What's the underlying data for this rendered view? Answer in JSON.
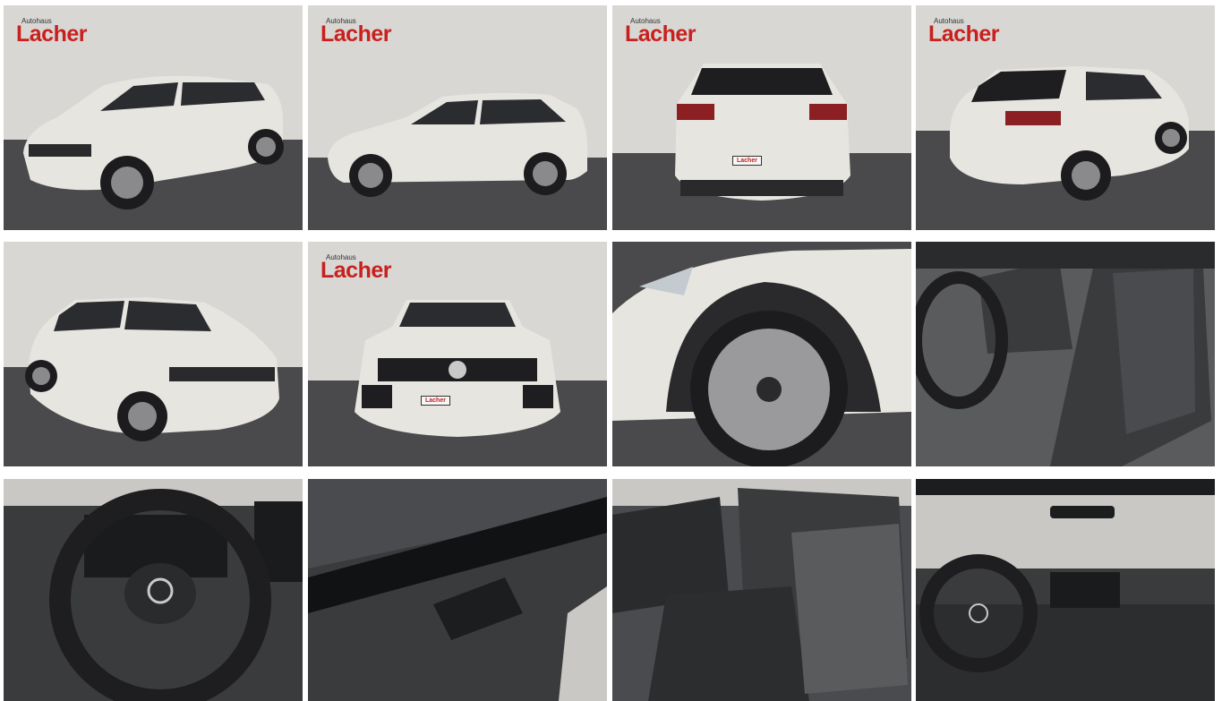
{
  "gallery": {
    "dealer": {
      "line1": "Autohaus",
      "line2": "Lacher",
      "brand_color": "#c8201f"
    },
    "plate_text": "Lacher",
    "photos": [
      {
        "subject": "front-left-exterior",
        "has_logo": true
      },
      {
        "subject": "side-exterior",
        "has_logo": true
      },
      {
        "subject": "rear-exterior",
        "has_logo": true
      },
      {
        "subject": "rear-right-exterior",
        "has_logo": true
      },
      {
        "subject": "front-left-exterior-2",
        "has_logo": false
      },
      {
        "subject": "front-exterior",
        "has_logo": true
      },
      {
        "subject": "wheel-closeup",
        "has_logo": false
      },
      {
        "subject": "front-seats",
        "has_logo": false
      },
      {
        "subject": "steering-wheel",
        "has_logo": false
      },
      {
        "subject": "door-panel",
        "has_logo": false
      },
      {
        "subject": "rear-seats",
        "has_logo": false
      },
      {
        "subject": "dashboard",
        "has_logo": false
      }
    ],
    "colors": {
      "backdrop": "#d9d8d5",
      "floor": "#4a4a4c",
      "car_body": "#e6e4df",
      "car_dark": "#1e1e20",
      "interior": "#3a3b3d"
    }
  }
}
